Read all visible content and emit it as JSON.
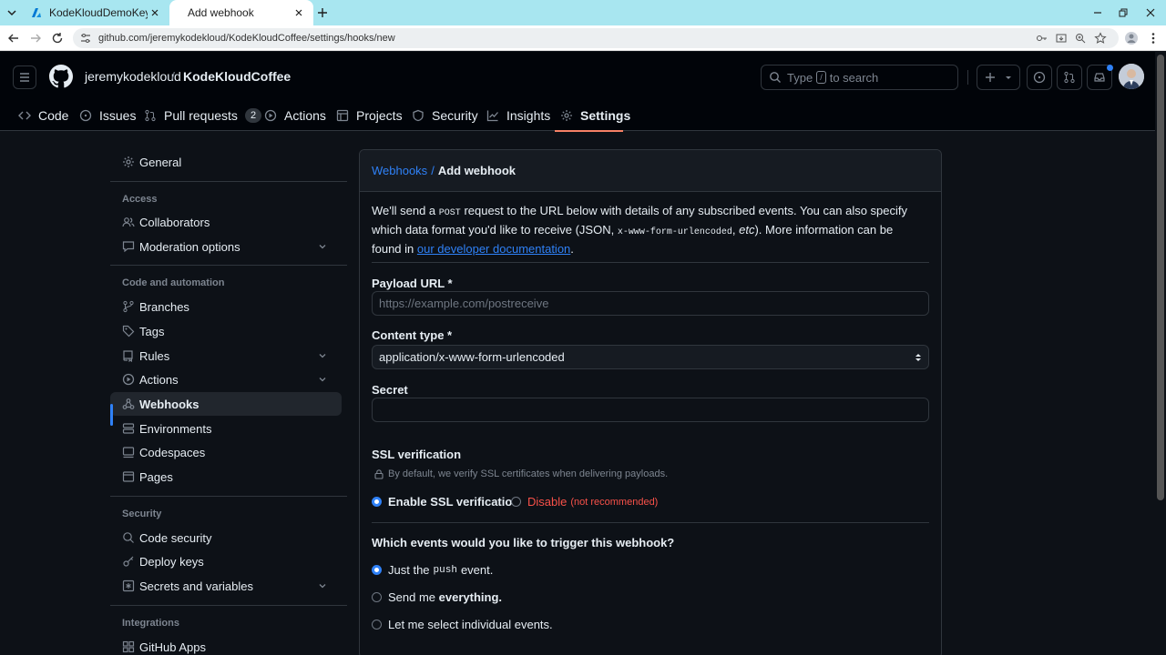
{
  "browser": {
    "tabs": [
      {
        "title": "KodeKloudDemoKeyVault - Mic",
        "active": false
      },
      {
        "title": "Add webhook",
        "active": true
      }
    ],
    "url": "github.com/jeremykodekloud/KodeKloudCoffee/settings/hooks/new"
  },
  "header": {
    "owner": "jeremykodekloud",
    "separator": "/",
    "repo": "KodeKloudCoffee",
    "search": {
      "prefix": "Type",
      "key": "/",
      "suffix": "to search"
    }
  },
  "repo_nav": {
    "code": "Code",
    "issues": "Issues",
    "pull_requests": "Pull requests",
    "pull_requests_count": "2",
    "actions": "Actions",
    "projects": "Projects",
    "security": "Security",
    "insights": "Insights",
    "settings": "Settings"
  },
  "sidebar": {
    "general": "General",
    "access_heading": "Access",
    "collaborators": "Collaborators",
    "moderation": "Moderation options",
    "code_heading": "Code and automation",
    "branches": "Branches",
    "tags": "Tags",
    "rules": "Rules",
    "actions": "Actions",
    "webhooks": "Webhooks",
    "environments": "Environments",
    "codespaces": "Codespaces",
    "pages": "Pages",
    "security_heading": "Security",
    "code_security": "Code security",
    "deploy_keys": "Deploy keys",
    "secrets": "Secrets and variables",
    "integrations_heading": "Integrations",
    "github_apps": "GitHub Apps"
  },
  "panel": {
    "breadcrumb_link": "Webhooks",
    "breadcrumb_sep": "/",
    "title": "Add webhook",
    "intro": {
      "p1": "We'll send a",
      "post": "POST",
      "p2": "request to the URL below with details of any subscribed events. You can also specify which data format you'd like to receive (JSON,",
      "form": "x-www-form-urlencoded",
      "p3": ",",
      "etc": "etc",
      "p4": "). More information can be found in",
      "link": "our developer documentation",
      "p5": "."
    },
    "payload_label": "Payload URL *",
    "payload_placeholder": "https://example.com/postreceive",
    "payload_value": "",
    "content_label": "Content type *",
    "content_value": "application/x-www-form-urlencoded",
    "secret_label": "Secret",
    "secret_value": "",
    "ssl_heading": "SSL verification",
    "ssl_hint": "By default, we verify SSL certificates when delivering payloads.",
    "ssl_enable": "Enable SSL verification",
    "ssl_disable": "Disable",
    "ssl_disable_note": "(not recommended)",
    "events_heading": "Which events would you like to trigger this webhook?",
    "event_push_a": "Just the",
    "event_push_code": "push",
    "event_push_b": "event.",
    "event_all_a": "Send me",
    "event_all_b": "everything.",
    "event_individual": "Let me select individual events."
  },
  "colors": {
    "accent": "#2f81f7",
    "danger": "#f85149",
    "tab_underline": "#f78166",
    "background": "#0d1117",
    "tabstrip": "#a8e6f0"
  }
}
